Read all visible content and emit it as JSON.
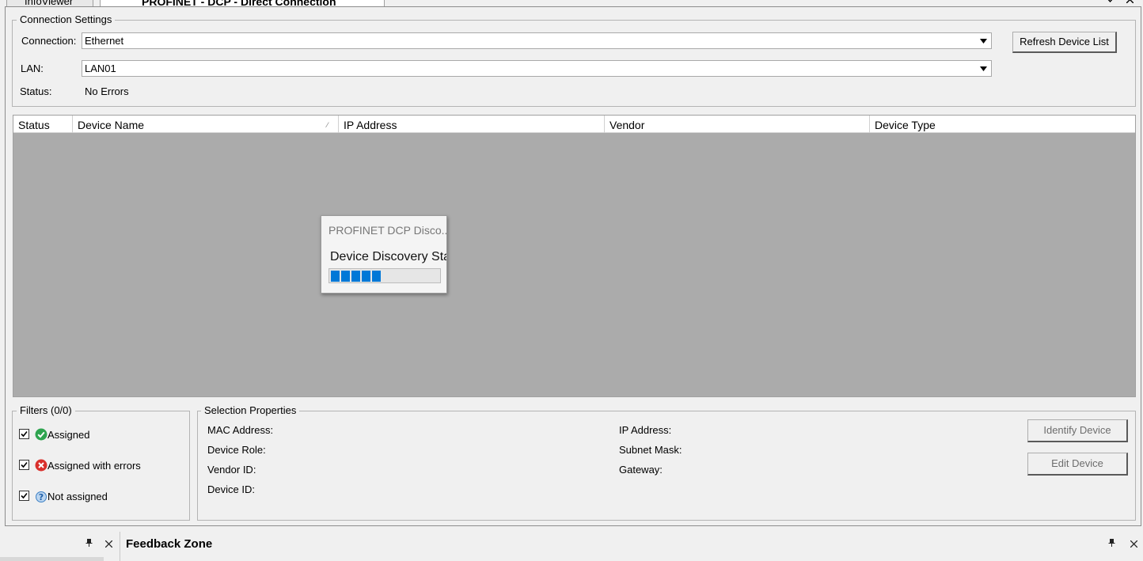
{
  "tabs": [
    {
      "label": "InfoViewer",
      "active": false
    },
    {
      "label": "PROFINET - DCP - Direct Connection",
      "active": true
    }
  ],
  "window_controls": {
    "dropdown_icon": "chevron-down-icon",
    "close_icon": "close-icon"
  },
  "connection_settings": {
    "legend": "Connection Settings",
    "connection_label": "Connection:",
    "connection_value": "Ethernet",
    "lan_label": "LAN:",
    "lan_value": "LAN01",
    "status_label": "Status:",
    "status_value": "No Errors",
    "refresh_button": "Refresh Device List"
  },
  "device_grid": {
    "columns": [
      "Status",
      "Device Name",
      "IP Address",
      "Vendor",
      "Device Type"
    ],
    "rows": []
  },
  "discovery_popup": {
    "title": "PROFINET DCP Disco...",
    "message": "Device Discovery Sta",
    "progress_blocks": 5
  },
  "filters": {
    "legend": "Filters  (0/0)",
    "items": [
      {
        "label": "Assigned",
        "checked": true,
        "icon": "check-circle-icon",
        "color": "#2ea44f"
      },
      {
        "label": "Assigned with errors",
        "checked": true,
        "icon": "error-circle-icon",
        "color": "#d9302c"
      },
      {
        "label": "Not assigned",
        "checked": true,
        "icon": "question-icon",
        "color": "#3c7fc4"
      }
    ]
  },
  "selection_properties": {
    "legend": "Selection Properties",
    "left_fields": [
      "MAC Address:",
      "Device Role:",
      "Vendor ID:",
      "Device ID:"
    ],
    "right_fields": [
      "IP Address:",
      "Subnet Mask:",
      "Gateway:"
    ],
    "identify_button": "Identify Device",
    "edit_button": "Edit Device"
  },
  "feedback_zone": {
    "title": "Feedback Zone",
    "pin_icon": "pin-icon",
    "close_icon": "close-icon"
  },
  "colors": {
    "progress": "#0078d7",
    "grid_background": "#ababab"
  }
}
